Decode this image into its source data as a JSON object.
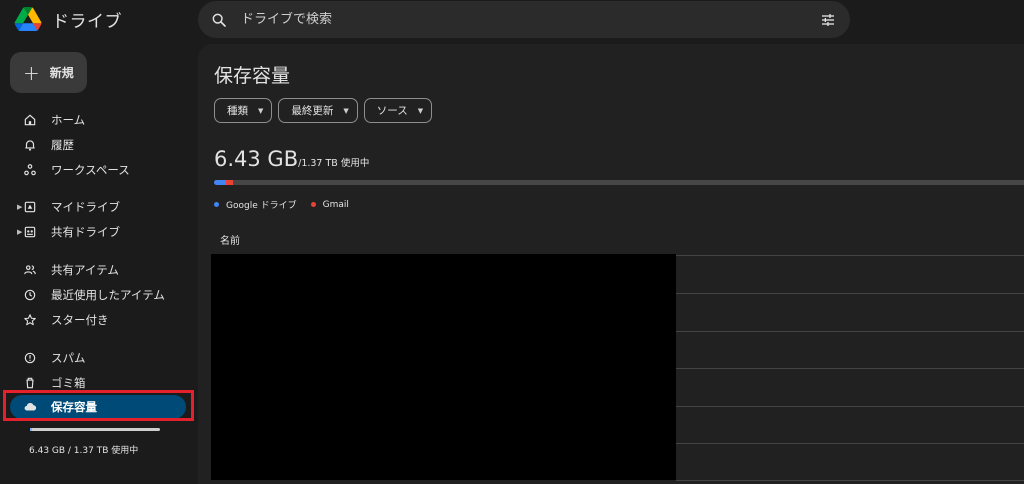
{
  "app": {
    "title": "ドライブ"
  },
  "search": {
    "placeholder": "ドライブで検索"
  },
  "sidebar": {
    "new_label": "新規",
    "items": [
      {
        "label": "ホーム"
      },
      {
        "label": "履歴"
      },
      {
        "label": "ワークスペース"
      },
      {
        "label": "マイドライブ"
      },
      {
        "label": "共有ドライブ"
      },
      {
        "label": "共有アイテム"
      },
      {
        "label": "最近使用したアイテム"
      },
      {
        "label": "スター付き"
      },
      {
        "label": "スパム"
      },
      {
        "label": "ゴミ箱"
      },
      {
        "label": "保存容量"
      }
    ],
    "storage_text": "6.43 GB / 1.37 TB 使用中",
    "storage_fraction": 0.0047
  },
  "main": {
    "title": "保存容量",
    "filters": [
      "種類",
      "最終更新",
      "ソース"
    ],
    "usage_amount": "6.43 GB",
    "usage_total": "/1.37 TB 使用中",
    "legend": [
      {
        "label": "Google ドライブ",
        "color": "#4285f4"
      },
      {
        "label": "Gmail",
        "color": "#ea4335"
      }
    ],
    "column_header": "名前"
  },
  "colors": {
    "active_nav": "#004a77",
    "highlight": "#e3202b"
  }
}
